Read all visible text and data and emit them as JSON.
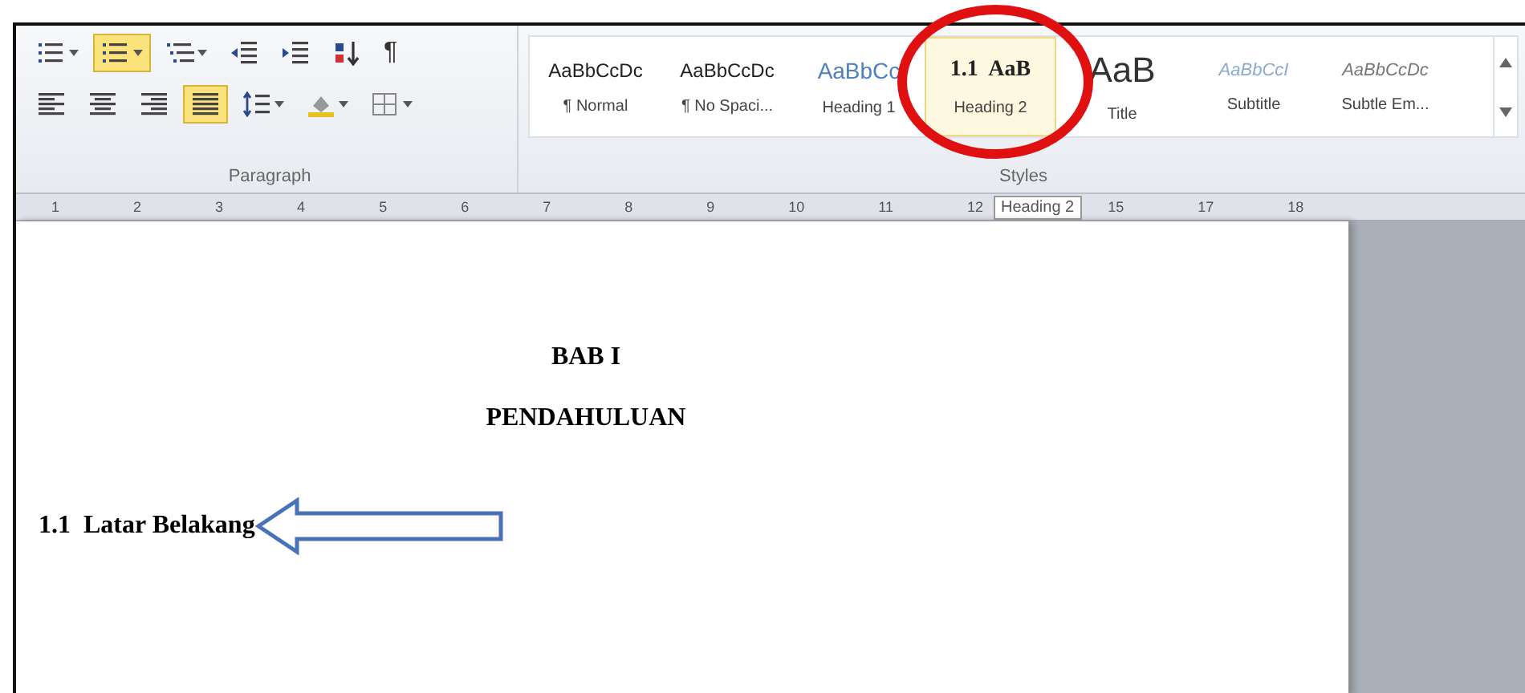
{
  "paragraph_group": {
    "label": "Paragraph",
    "rows": [
      [
        {
          "kind": "bullets",
          "selected": false,
          "dropdown": true
        },
        {
          "kind": "numbering",
          "selected": true,
          "dropdown": true
        },
        {
          "kind": "multilevel",
          "selected": false,
          "dropdown": true
        },
        {
          "kind": "decrease-indent",
          "selected": false,
          "dropdown": false
        },
        {
          "kind": "increase-indent",
          "selected": false,
          "dropdown": false
        },
        {
          "kind": "sort",
          "selected": false,
          "dropdown": false
        },
        {
          "kind": "pilcrow",
          "selected": false,
          "dropdown": false,
          "text": "¶"
        }
      ],
      [
        {
          "kind": "align-left",
          "selected": false,
          "dropdown": false
        },
        {
          "kind": "align-center",
          "selected": false,
          "dropdown": false
        },
        {
          "kind": "align-right",
          "selected": false,
          "dropdown": false
        },
        {
          "kind": "justify",
          "selected": true,
          "dropdown": false
        },
        {
          "kind": "line-spacing",
          "selected": false,
          "dropdown": true
        },
        {
          "kind": "shading",
          "selected": false,
          "dropdown": true
        },
        {
          "kind": "borders",
          "selected": false,
          "dropdown": true
        }
      ]
    ]
  },
  "styles_group": {
    "label": "Styles",
    "items": [
      {
        "preview": "AaBbCcDc",
        "name": "¶ Normal",
        "kind": "normal",
        "selected": false
      },
      {
        "preview": "AaBbCcDc",
        "name": "¶ No Spaci...",
        "kind": "normal",
        "selected": false
      },
      {
        "preview": "AaBbCc",
        "name": "Heading 1",
        "kind": "heading1",
        "selected": false
      },
      {
        "preview": "1.1  AaB",
        "name": "Heading 2",
        "kind": "heading2",
        "selected": true
      },
      {
        "preview": "AaB",
        "name": "Title",
        "kind": "title",
        "selected": false
      },
      {
        "preview": "AaBbCcI",
        "name": "Subtitle",
        "kind": "subtitle",
        "selected": false
      },
      {
        "preview": "AaBbCcDc",
        "name": "Subtle Em...",
        "kind": "emphasis",
        "selected": false
      }
    ]
  },
  "ruler": {
    "numbers": [
      "1",
      "2",
      "3",
      "4",
      "5",
      "6",
      "7",
      "8",
      "9",
      "10",
      "11",
      "12"
    ],
    "tooltip": "Heading 2",
    "numbers_after": [
      "15",
      "17",
      "18"
    ]
  },
  "document": {
    "title_lines": [
      "BAB I",
      "PENDAHULUAN"
    ],
    "heading": "1.1  Latar Belakang"
  }
}
